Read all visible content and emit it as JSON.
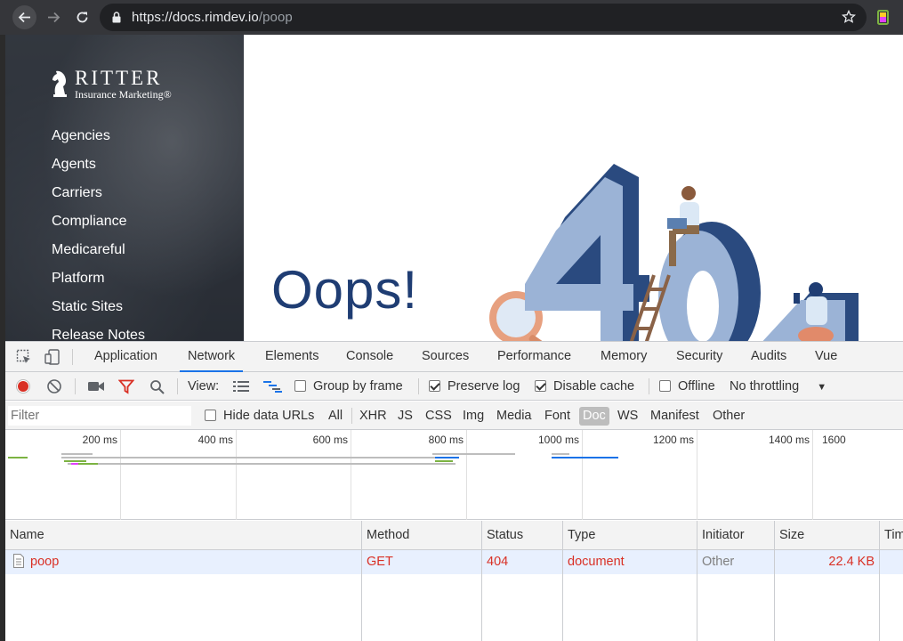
{
  "browser": {
    "url_host": "https://docs.rimdev.io",
    "url_path": "/poop"
  },
  "page": {
    "logo": {
      "name": "RITTER",
      "tagline": "Insurance Marketing®"
    },
    "menu": [
      "Agencies",
      "Agents",
      "Carriers",
      "Compliance",
      "Medicareful",
      "Platform",
      "Static Sites",
      "Release Notes"
    ],
    "headline": "Oops!",
    "illustration": "404-illustration",
    "colors": {
      "headline": "#1f3d73",
      "illustration_dark": "#2a4a7f",
      "illustration_light": "#9bb3d6"
    }
  },
  "devtools": {
    "tabs": [
      {
        "label": "Application",
        "active": false
      },
      {
        "label": "Network",
        "active": true
      },
      {
        "label": "Elements",
        "active": false
      },
      {
        "label": "Console",
        "active": false
      },
      {
        "label": "Sources",
        "active": false
      },
      {
        "label": "Performance",
        "active": false
      },
      {
        "label": "Memory",
        "active": false
      },
      {
        "label": "Security",
        "active": false
      },
      {
        "label": "Audits",
        "active": false
      },
      {
        "label": "Vue",
        "active": false
      }
    ],
    "toolbar": {
      "view_label": "View:",
      "group_by_frame": {
        "label": "Group by frame",
        "checked": false
      },
      "preserve_log": {
        "label": "Preserve log",
        "checked": true
      },
      "disable_cache": {
        "label": "Disable cache",
        "checked": true
      },
      "offline": {
        "label": "Offline",
        "checked": false
      },
      "throttling": "No throttling"
    },
    "filter": {
      "placeholder": "Filter",
      "hide_data_urls": {
        "label": "Hide data URLs",
        "checked": false
      },
      "types": [
        "All",
        "XHR",
        "JS",
        "CSS",
        "Img",
        "Media",
        "Font",
        "Doc",
        "WS",
        "Manifest",
        "Other"
      ],
      "selected_type": "Doc"
    },
    "timeline": {
      "ticks": [
        "200 ms",
        "400 ms",
        "600 ms",
        "800 ms",
        "1000 ms",
        "1200 ms",
        "1400 ms",
        "1600"
      ]
    },
    "table": {
      "columns": [
        "Name",
        "Method",
        "Status",
        "Type",
        "Initiator",
        "Size",
        "Tim"
      ],
      "rows": [
        {
          "name": "poop",
          "method": "GET",
          "status": "404",
          "type": "document",
          "initiator": "Other",
          "size": "22.4 KB"
        }
      ]
    }
  }
}
